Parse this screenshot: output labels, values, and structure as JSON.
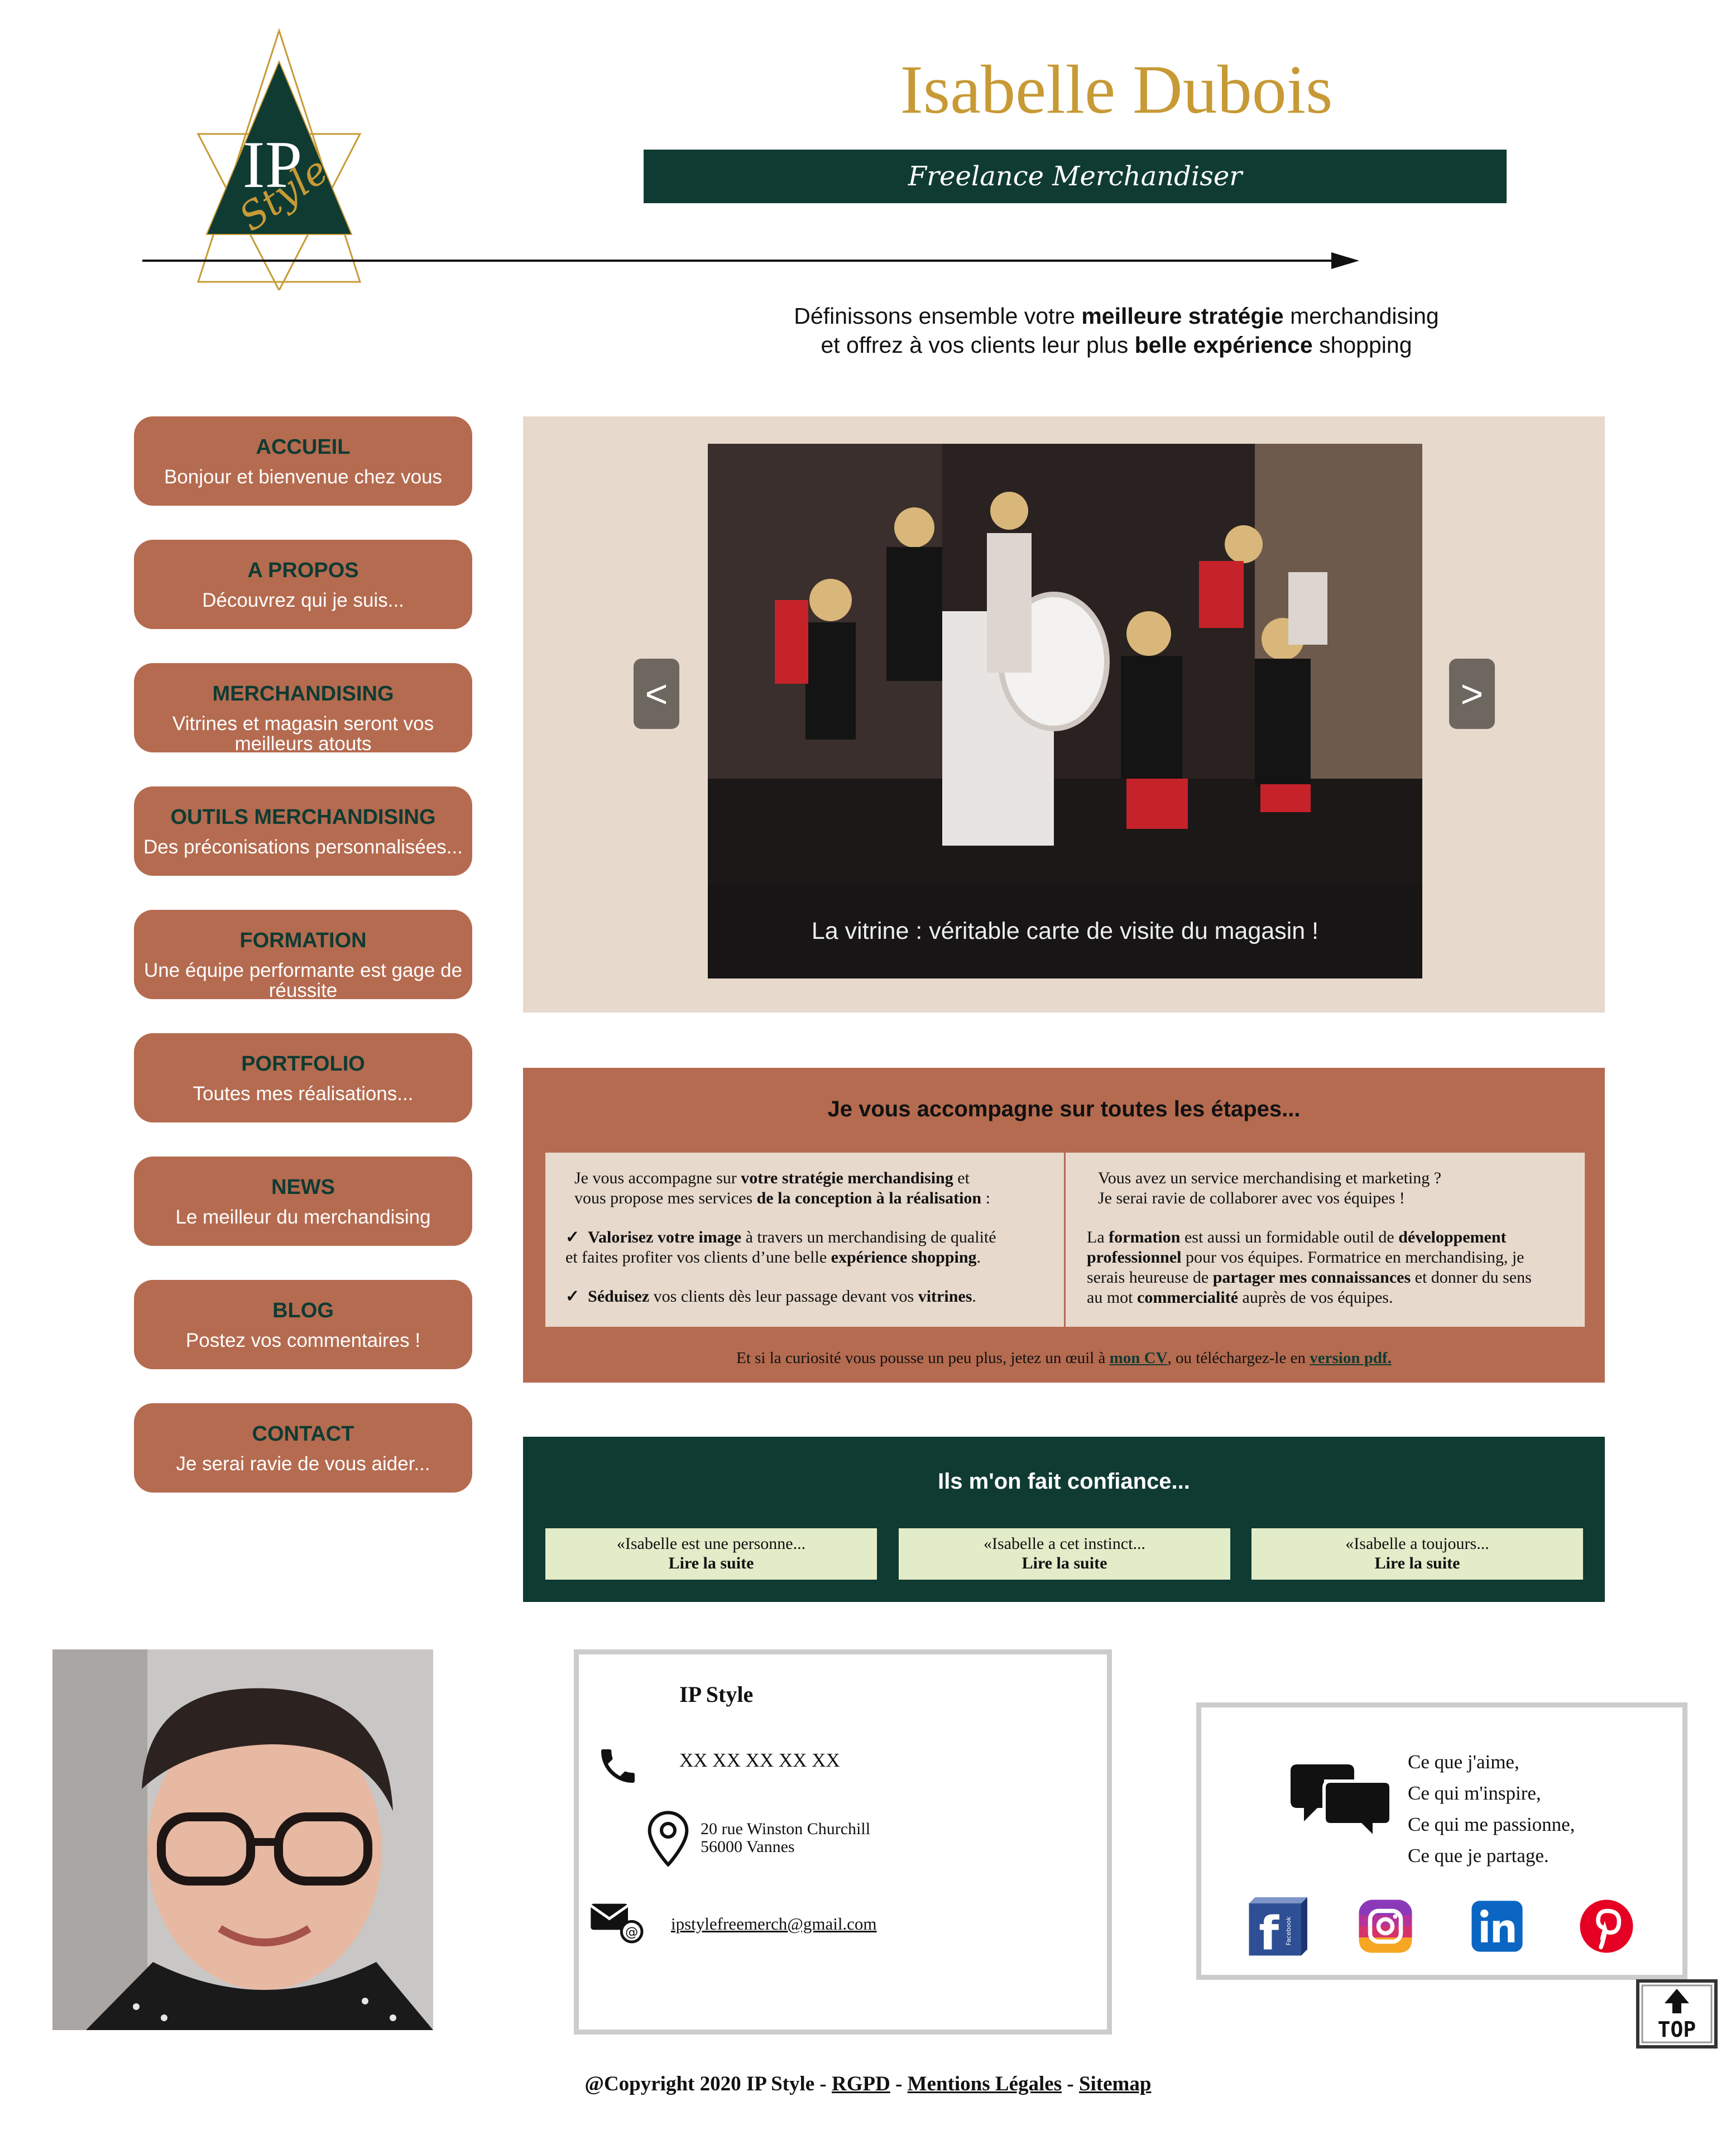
{
  "header": {
    "name": "Isabelle Dubois",
    "tagline": "Freelance Merchandiser",
    "logo_initials": "IP",
    "logo_word": "Style",
    "intro_line1_a": "Définissons ensemble votre ",
    "intro_line1_b": "meilleure stratégie",
    "intro_line1_c": " merchandising",
    "intro_line2_a": "et offrez à vos clients leur plus ",
    "intro_line2_b": "belle expérience",
    "intro_line2_c": " shopping"
  },
  "nav": [
    {
      "title": "ACCUEIL",
      "subtitle": "Bonjour et bienvenue chez vous"
    },
    {
      "title": "A PROPOS",
      "subtitle": "Découvrez qui je suis..."
    },
    {
      "title": "MERCHANDISING",
      "subtitle": "Vitrines et magasin seront vos meilleurs atouts"
    },
    {
      "title": "OUTILS MERCHANDISING",
      "subtitle": "Des préconisations personnalisées..."
    },
    {
      "title": "FORMATION",
      "subtitle": "Une équipe performante est gage de réussite"
    },
    {
      "title": "PORTFOLIO",
      "subtitle": "Toutes mes réalisations..."
    },
    {
      "title": "NEWS",
      "subtitle": "Le meilleur du merchandising"
    },
    {
      "title": "BLOG",
      "subtitle": "Postez vos commentaires !"
    },
    {
      "title": "CONTACT",
      "subtitle": "Je serai ravie de vous aider..."
    }
  ],
  "slider": {
    "prev": "<",
    "next": ">",
    "caption": "La vitrine : véritable carte de visite du magasin !"
  },
  "steps": {
    "title": "Je vous accompagne sur toutes les étapes...",
    "left": {
      "l1a": "Je vous accompagne sur ",
      "l1b": "votre stratégie merchandising",
      "l1c": " et",
      "l2a": "vous propose mes services ",
      "l2b": "de la conception à la réalisation",
      "l2c": " :",
      "check": "✓",
      "b1a": "Valorisez votre image",
      "b1b": " à travers un merchandising de qualité",
      "b1c": "et faites profiter vos clients d’une belle ",
      "b1d": "expérience shopping",
      "b1e": ".",
      "b2a": "Séduisez",
      "b2b": " vos clients dès leur passage devant vos ",
      "b2c": "vitrines",
      "b2d": "."
    },
    "right": {
      "l1": "Vous avez un service merchandising et marketing ?",
      "l2": "Je serai ravie de collaborer avec vos équipes !",
      "p1a": "La ",
      "p1b": "formation",
      "p1c": " est aussi un formidable outil de ",
      "p1d": "développement",
      "p2a": "professionnel",
      "p2b": " pour vos équipes. Formatrice en merchandising, je",
      "p3a": "serais heureuse de ",
      "p3b": "partager mes connaissances",
      "p3c": " et donner du sens",
      "p4a": "au mot ",
      "p4b": "commercialité",
      "p4c": " auprès de vos équipes."
    },
    "footer_a": "Et si la curiosité vous pousse un peu plus, jetez un œuil à ",
    "footer_link1": "mon CV",
    "footer_b": ", ou téléchargez-le en ",
    "footer_link2": "version pdf."
  },
  "trust": {
    "title": "Ils m'on fait confiance...",
    "quotes": [
      {
        "text": "«Isabelle est une personne...",
        "more": "Lire la suite"
      },
      {
        "text": "«Isabelle a cet instinct...",
        "more": "Lire la suite"
      },
      {
        "text": "«Isabelle a toujours...",
        "more": "Lire la suite"
      }
    ]
  },
  "contact": {
    "company": "IP Style",
    "phone": "XX XX XX XX XX",
    "address1": "20 rue Winston Churchill",
    "address2": "56000 Vannes",
    "email": "ipstylefreemerch@gmail.com"
  },
  "social": {
    "lines": [
      "Ce que j'aime,",
      "Ce qui m'inspire,",
      "Ce qui me passionne,",
      "Ce que je partage."
    ],
    "facebook_label": "Facebook",
    "networks": [
      "facebook-icon",
      "instagram-icon",
      "linkedin-icon",
      "pinterest-icon"
    ]
  },
  "top_button": "TOP",
  "footer": {
    "copyright": "@Copyright 2020 IP Style",
    "sep": " - ",
    "rgpd": "RGPD",
    "legal": "Mentions Légales",
    "sitemap": "Sitemap"
  },
  "colors": {
    "terracotta": "#b56b50",
    "dark_green": "#0f3b32",
    "gold": "#c79a36",
    "beige": "#e7d9cc",
    "quote_bg": "#e3ecc9"
  }
}
